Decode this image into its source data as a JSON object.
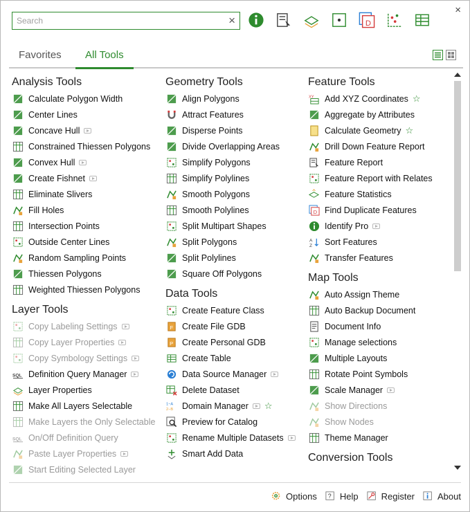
{
  "window": {
    "close_glyph": "×"
  },
  "search": {
    "placeholder": "Search",
    "value": "",
    "clear_glyph": "×"
  },
  "toolbar_icons": [
    "identify-pro-icon",
    "feature-report-icon",
    "layer-properties-icon",
    "center-icon",
    "duplicate-features-icon",
    "random-points-icon",
    "create-table-icon"
  ],
  "tabs": [
    {
      "label": "Favorites",
      "active": false
    },
    {
      "label": "All Tools",
      "active": true
    }
  ],
  "columns": [
    {
      "sections": [
        {
          "title": "Analysis Tools",
          "items": [
            {
              "label": "Calculate Polygon Width",
              "icon": "polygon-width-icon"
            },
            {
              "label": "Center Lines",
              "icon": "center-lines-icon"
            },
            {
              "label": "Concave Hull",
              "icon": "concave-hull-icon",
              "video": true
            },
            {
              "label": "Constrained Thiessen Polygons",
              "icon": "constrained-thiessen-icon"
            },
            {
              "label": "Convex Hull",
              "icon": "convex-hull-icon",
              "video": true
            },
            {
              "label": "Create Fishnet",
              "icon": "fishnet-icon",
              "video": true
            },
            {
              "label": "Eliminate Slivers",
              "icon": "eliminate-slivers-icon"
            },
            {
              "label": "Fill Holes",
              "icon": "fill-holes-icon"
            },
            {
              "label": "Intersection Points",
              "icon": "intersection-points-icon"
            },
            {
              "label": "Outside Center Lines",
              "icon": "outside-center-lines-icon"
            },
            {
              "label": "Random Sampling Points",
              "icon": "random-sampling-icon"
            },
            {
              "label": "Thiessen Polygons",
              "icon": "thiessen-icon"
            },
            {
              "label": "Weighted Thiessen Polygons",
              "icon": "weighted-thiessen-icon"
            }
          ]
        },
        {
          "title": "Layer Tools",
          "items": [
            {
              "label": "Copy Labeling Settings",
              "icon": "copy-labeling-icon",
              "video": true,
              "disabled": true
            },
            {
              "label": "Copy Layer Properties",
              "icon": "copy-layer-properties-icon",
              "video": true,
              "disabled": true
            },
            {
              "label": "Copy Symbology Settings",
              "icon": "copy-symbology-icon",
              "video": true,
              "disabled": true
            },
            {
              "label": "Definition Query Manager",
              "icon": "sql-icon",
              "video": true
            },
            {
              "label": "Layer Properties",
              "icon": "layer-properties-icon"
            },
            {
              "label": "Make All Layers Selectable",
              "icon": "make-selectable-icon"
            },
            {
              "label": "Make Layers the Only Selectable",
              "icon": "only-selectable-icon",
              "disabled": true
            },
            {
              "label": "On/Off Definition Query",
              "icon": "sql-icon",
              "disabled": true
            },
            {
              "label": "Paste Layer Properties",
              "icon": "paste-layer-icon",
              "video": true,
              "disabled": true
            },
            {
              "label": "Start Editing Selected Layer",
              "icon": "start-editing-icon",
              "disabled": true
            }
          ]
        }
      ]
    },
    {
      "sections": [
        {
          "title": "Geometry Tools",
          "items": [
            {
              "label": "Align Polygons",
              "icon": "align-polygons-icon"
            },
            {
              "label": "Attract Features",
              "icon": "magnet-icon"
            },
            {
              "label": "Disperse Points",
              "icon": "disperse-points-icon"
            },
            {
              "label": "Divide Overlapping Areas",
              "icon": "divide-overlapping-icon"
            },
            {
              "label": "Simplify Polygons",
              "icon": "simplify-polygons-icon"
            },
            {
              "label": "Simplify Polylines",
              "icon": "simplify-polylines-icon"
            },
            {
              "label": "Smooth Polygons",
              "icon": "smooth-polygons-icon"
            },
            {
              "label": "Smooth Polylines",
              "icon": "smooth-polylines-icon"
            },
            {
              "label": "Split Multipart Shapes",
              "icon": "split-multipart-icon"
            },
            {
              "label": "Split Polygons",
              "icon": "split-polygons-icon"
            },
            {
              "label": "Split Polylines",
              "icon": "split-polylines-icon"
            },
            {
              "label": "Square Off Polygons",
              "icon": "square-off-icon"
            }
          ]
        },
        {
          "title": "Data Tools",
          "items": [
            {
              "label": "Create Feature Class",
              "icon": "create-feature-class-icon"
            },
            {
              "label": "Create File GDB",
              "icon": "file-gdb-icon"
            },
            {
              "label": "Create Personal GDB",
              "icon": "personal-gdb-icon"
            },
            {
              "label": "Create Table",
              "icon": "create-table-icon"
            },
            {
              "label": "Data Source Manager",
              "icon": "data-source-icon",
              "video": true
            },
            {
              "label": "Delete Dataset",
              "icon": "delete-dataset-icon"
            },
            {
              "label": "Domain Manager",
              "icon": "domain-icon",
              "video": true,
              "favorite": true
            },
            {
              "label": "Preview for Catalog",
              "icon": "preview-icon"
            },
            {
              "label": "Rename Multiple Datasets",
              "icon": "rename-icon",
              "video": true
            },
            {
              "label": "Smart Add Data",
              "icon": "smart-add-icon"
            }
          ]
        }
      ]
    },
    {
      "sections": [
        {
          "title": "Feature Tools",
          "items": [
            {
              "label": "Add XYZ Coordinates",
              "icon": "xyz-icon",
              "favorite": true
            },
            {
              "label": "Aggregate by Attributes",
              "icon": "aggregate-icon"
            },
            {
              "label": "Calculate Geometry",
              "icon": "calculate-geometry-icon",
              "favorite": true
            },
            {
              "label": "Drill Down Feature Report",
              "icon": "drill-down-icon"
            },
            {
              "label": "Feature Report",
              "icon": "feature-report-icon"
            },
            {
              "label": "Feature Report with Relates",
              "icon": "feature-report-relates-icon"
            },
            {
              "label": "Feature Statistics",
              "icon": "feature-statistics-icon"
            },
            {
              "label": "Find Duplicate Features",
              "icon": "duplicate-features-icon"
            },
            {
              "label": "Identify Pro",
              "icon": "identify-pro-icon",
              "video": true
            },
            {
              "label": "Sort Features",
              "icon": "sort-icon"
            },
            {
              "label": "Transfer Features",
              "icon": "transfer-icon"
            }
          ]
        },
        {
          "title": "Map Tools",
          "items": [
            {
              "label": "Auto Assign Theme",
              "icon": "auto-theme-icon"
            },
            {
              "label": "Auto Backup Document",
              "icon": "auto-backup-icon"
            },
            {
              "label": "Document Info",
              "icon": "document-info-icon"
            },
            {
              "label": "Manage selections",
              "icon": "manage-selections-icon"
            },
            {
              "label": "Multiple Layouts",
              "icon": "multiple-layouts-icon"
            },
            {
              "label": "Rotate Point Symbols",
              "icon": "rotate-symbols-icon"
            },
            {
              "label": "Scale Manager",
              "icon": "scale-manager-icon",
              "video": true
            },
            {
              "label": "Show Directions",
              "icon": "show-directions-icon",
              "disabled": true
            },
            {
              "label": "Show Nodes",
              "icon": "show-nodes-icon",
              "disabled": true
            },
            {
              "label": "Theme Manager",
              "icon": "theme-manager-icon"
            }
          ]
        },
        {
          "title": "Conversion Tools",
          "items": []
        }
      ]
    }
  ],
  "footer": [
    {
      "label": "Options",
      "icon": "gear-icon"
    },
    {
      "label": "Help",
      "icon": "help-icon"
    },
    {
      "label": "Register",
      "icon": "key-icon"
    },
    {
      "label": "About",
      "icon": "info-icon"
    }
  ],
  "colors": {
    "accent": "#2e8b2e",
    "muted_text": "#9a9a9a",
    "icon_orange": "#e8a33c",
    "icon_blue": "#2a7fd4",
    "icon_red": "#d43b3b"
  }
}
